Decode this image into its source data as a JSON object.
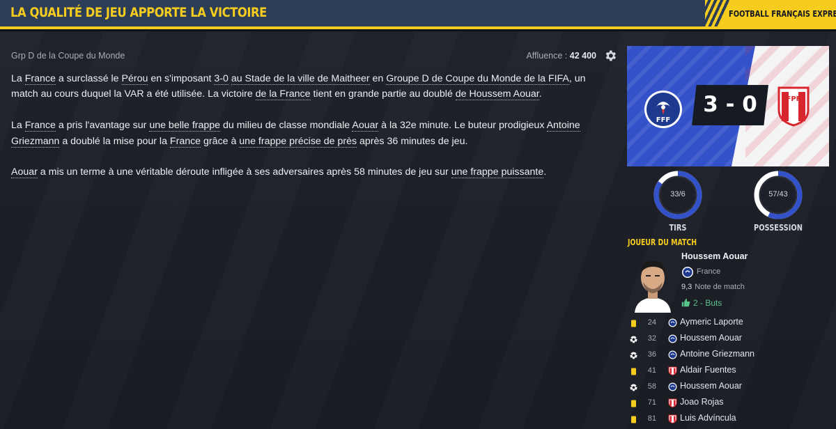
{
  "header": {
    "title": "LA QUALITÉ DE JEU APPORTE LA VICTOIRE",
    "brand": "FOOTBALL FRANÇAIS EXPRESS"
  },
  "subheader": {
    "group": "Grp D de la Coupe du Monde",
    "attendance_label": "Affluence :",
    "attendance_value": "42 400"
  },
  "article": {
    "p1": [
      {
        "t": "La ",
        "u": false
      },
      {
        "t": "France",
        "u": true
      },
      {
        "t": " a surclassé le ",
        "u": false
      },
      {
        "t": "Pérou",
        "u": true
      },
      {
        "t": " en s'imposant ",
        "u": false
      },
      {
        "t": "3-0",
        "u": true
      },
      {
        "t": " ",
        "u": false
      },
      {
        "t": "au Stade de la ville de Maitheer",
        "u": true
      },
      {
        "t": " en ",
        "u": false
      },
      {
        "t": "Groupe D de Coupe du Monde de la FIFA",
        "u": true
      },
      {
        "t": ", un match au cours duquel la VAR a été utilisée. La victoire ",
        "u": false
      },
      {
        "t": "de la France",
        "u": true
      },
      {
        "t": " tient en grande partie au doublé ",
        "u": false
      },
      {
        "t": "de Houssem Aouar",
        "u": true
      },
      {
        "t": ".",
        "u": false
      }
    ],
    "p2": [
      {
        "t": "La ",
        "u": false
      },
      {
        "t": "France",
        "u": true
      },
      {
        "t": " a pris l'avantage sur ",
        "u": false
      },
      {
        "t": "une belle frappe",
        "u": true
      },
      {
        "t": " du milieu de classe mondiale ",
        "u": false
      },
      {
        "t": "Aouar",
        "u": true
      },
      {
        "t": " à la 32e minute. Le buteur prodigieux ",
        "u": false
      },
      {
        "t": "Antoine Griezmann",
        "u": true
      },
      {
        "t": " a doublé la mise pour la ",
        "u": false
      },
      {
        "t": "France",
        "u": true
      },
      {
        "t": " grâce à ",
        "u": false
      },
      {
        "t": "une frappe précise de près",
        "u": true
      },
      {
        "t": " après 36 minutes de jeu.",
        "u": false
      }
    ],
    "p3": [
      {
        "t": "Aouar",
        "u": true
      },
      {
        "t": " a mis un terme à une véritable déroute infligée à ses adversaires après 58 minutes de jeu sur ",
        "u": false
      },
      {
        "t": "une frappe puissante",
        "u": true
      },
      {
        "t": ".",
        "u": false
      }
    ]
  },
  "match": {
    "score": "3 - 0",
    "home_crest_text": "FFF",
    "away_crest_text": "FPF",
    "home_color": "#3351c9",
    "away_color": "#d8262f"
  },
  "stats": {
    "shots": {
      "value": "33/6",
      "label": "TIRS",
      "home": 33,
      "away": 6
    },
    "possession": {
      "value": "57/43",
      "label": "POSSESSION",
      "home": 57,
      "away": 43
    }
  },
  "motm": {
    "title": "JOUEUR DU MATCH",
    "name": "Houssem Aouar",
    "team": "France",
    "rating": "9,3",
    "rating_label": "Note de match",
    "goals": "2 - Buts"
  },
  "events": [
    {
      "type": "yellow-card",
      "minute": "24",
      "team": "fra",
      "player": "Aymeric Laporte"
    },
    {
      "type": "goal",
      "minute": "32",
      "team": "fra",
      "player": "Houssem Aouar"
    },
    {
      "type": "goal",
      "minute": "36",
      "team": "fra",
      "player": "Antoine Griezmann"
    },
    {
      "type": "yellow-card",
      "minute": "41",
      "team": "per",
      "player": "Aldair Fuentes"
    },
    {
      "type": "goal",
      "minute": "58",
      "team": "fra",
      "player": "Houssem Aouar"
    },
    {
      "type": "yellow-card",
      "minute": "71",
      "team": "per",
      "player": "Joao Rojas"
    },
    {
      "type": "yellow-card",
      "minute": "81",
      "team": "per",
      "player": "Luis Advíncula"
    }
  ],
  "colors": {
    "accent": "#f6cd1f",
    "header_bg": "#2c3e57",
    "ring_home": "#3351c9",
    "ring_away": "#ffffff",
    "positive": "#59c48a"
  }
}
